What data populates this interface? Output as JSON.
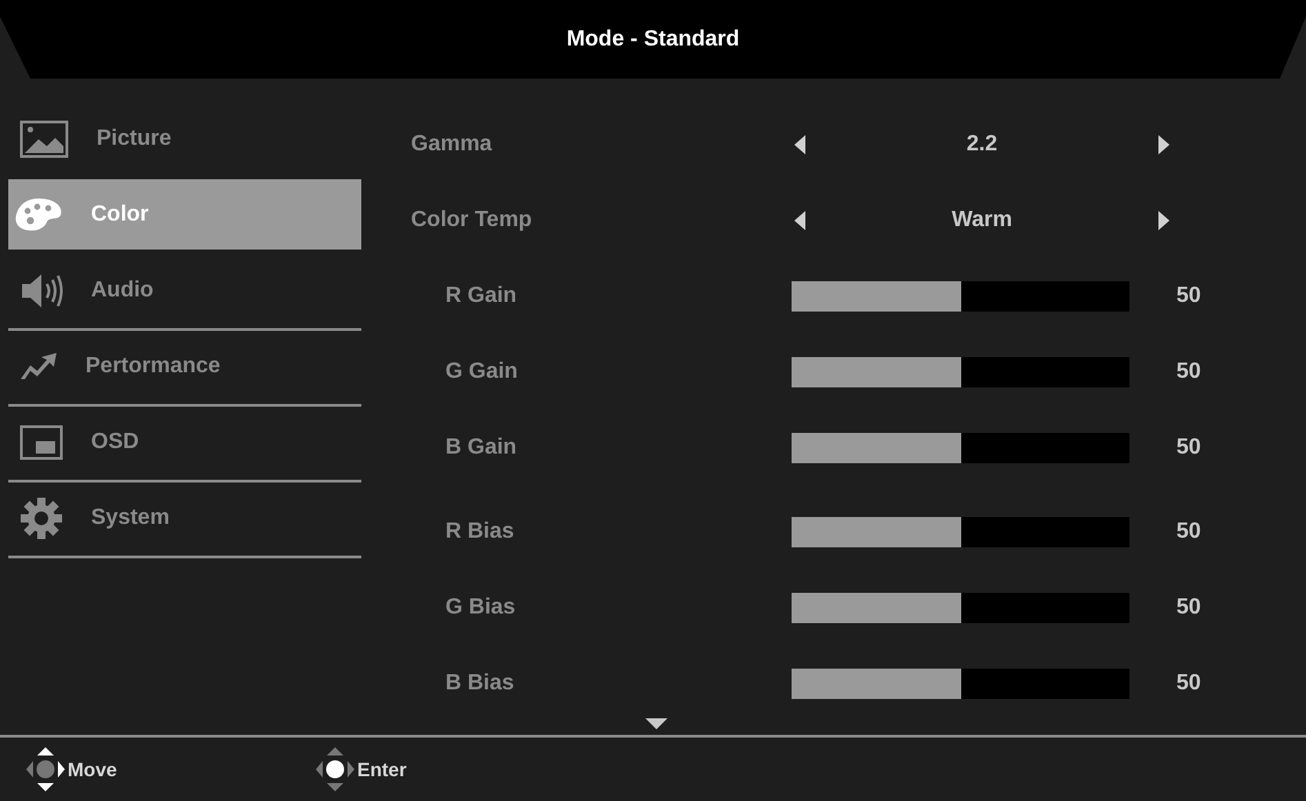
{
  "header": {
    "title": "Mode - Standard"
  },
  "menu": [
    {
      "label": "Picture",
      "selected": false
    },
    {
      "label": "Color",
      "selected": true
    },
    {
      "label": "Audio",
      "selected": false
    },
    {
      "label": "Pertormance",
      "selected": false
    },
    {
      "label": "OSD",
      "selected": false
    },
    {
      "label": "System",
      "selected": false
    }
  ],
  "settings": [
    {
      "kind": "choice",
      "label": "Gamma",
      "value": "2.2"
    },
    {
      "kind": "choice",
      "label": "Color Temp",
      "value": "Warm"
    },
    {
      "kind": "slider",
      "label": "R Gain",
      "level": 0.5,
      "reading": "50"
    },
    {
      "kind": "slider",
      "label": "G Gain",
      "level": 0.5,
      "reading": "50"
    },
    {
      "kind": "slider",
      "label": "B Gain",
      "level": 0.5,
      "reading": "50"
    },
    {
      "kind": "slider",
      "label": "R Bias",
      "level": 0.5,
      "reading": "50"
    },
    {
      "kind": "slider",
      "label": "G Bias",
      "level": 0.5,
      "reading": "50"
    },
    {
      "kind": "slider",
      "label": "B Bias",
      "level": 0.5,
      "reading": "50"
    }
  ],
  "footer": [
    {
      "label": "Move"
    },
    {
      "label": "Enter"
    }
  ]
}
